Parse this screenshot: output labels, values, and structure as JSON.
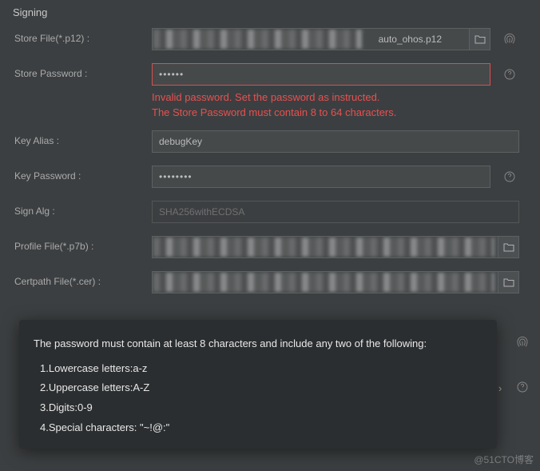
{
  "section_title": "Signing",
  "fields": {
    "store_file": {
      "label": "Store File(*.p12) :",
      "value": "auto_ohos.p12"
    },
    "store_password": {
      "label": "Store Password :",
      "value": "••••••",
      "error_line1": "Invalid password. Set the password as instructed.",
      "error_line2": "The Store Password must contain 8 to 64 characters."
    },
    "key_alias": {
      "label": "Key Alias :",
      "value": "debugKey"
    },
    "key_password": {
      "label": "Key Password :",
      "value": "••••••••"
    },
    "sign_alg": {
      "label": "Sign Alg :",
      "value": "SHA256withECDSA"
    },
    "profile_file": {
      "label": "Profile File(*.p7b) :",
      "value": ""
    },
    "certpath_file": {
      "label": "Certpath File(*.cer) :",
      "value": ""
    }
  },
  "tooltip": {
    "title": "The password must contain at least 8 characters and include any two of the following:",
    "item1": "1.Lowercase letters:a-z",
    "item2": "2.Uppercase letters:A-Z",
    "item3": "3.Digits:0-9",
    "item4": "4.Special characters: \"~!@:\""
  },
  "watermark": "@51CTO博客"
}
